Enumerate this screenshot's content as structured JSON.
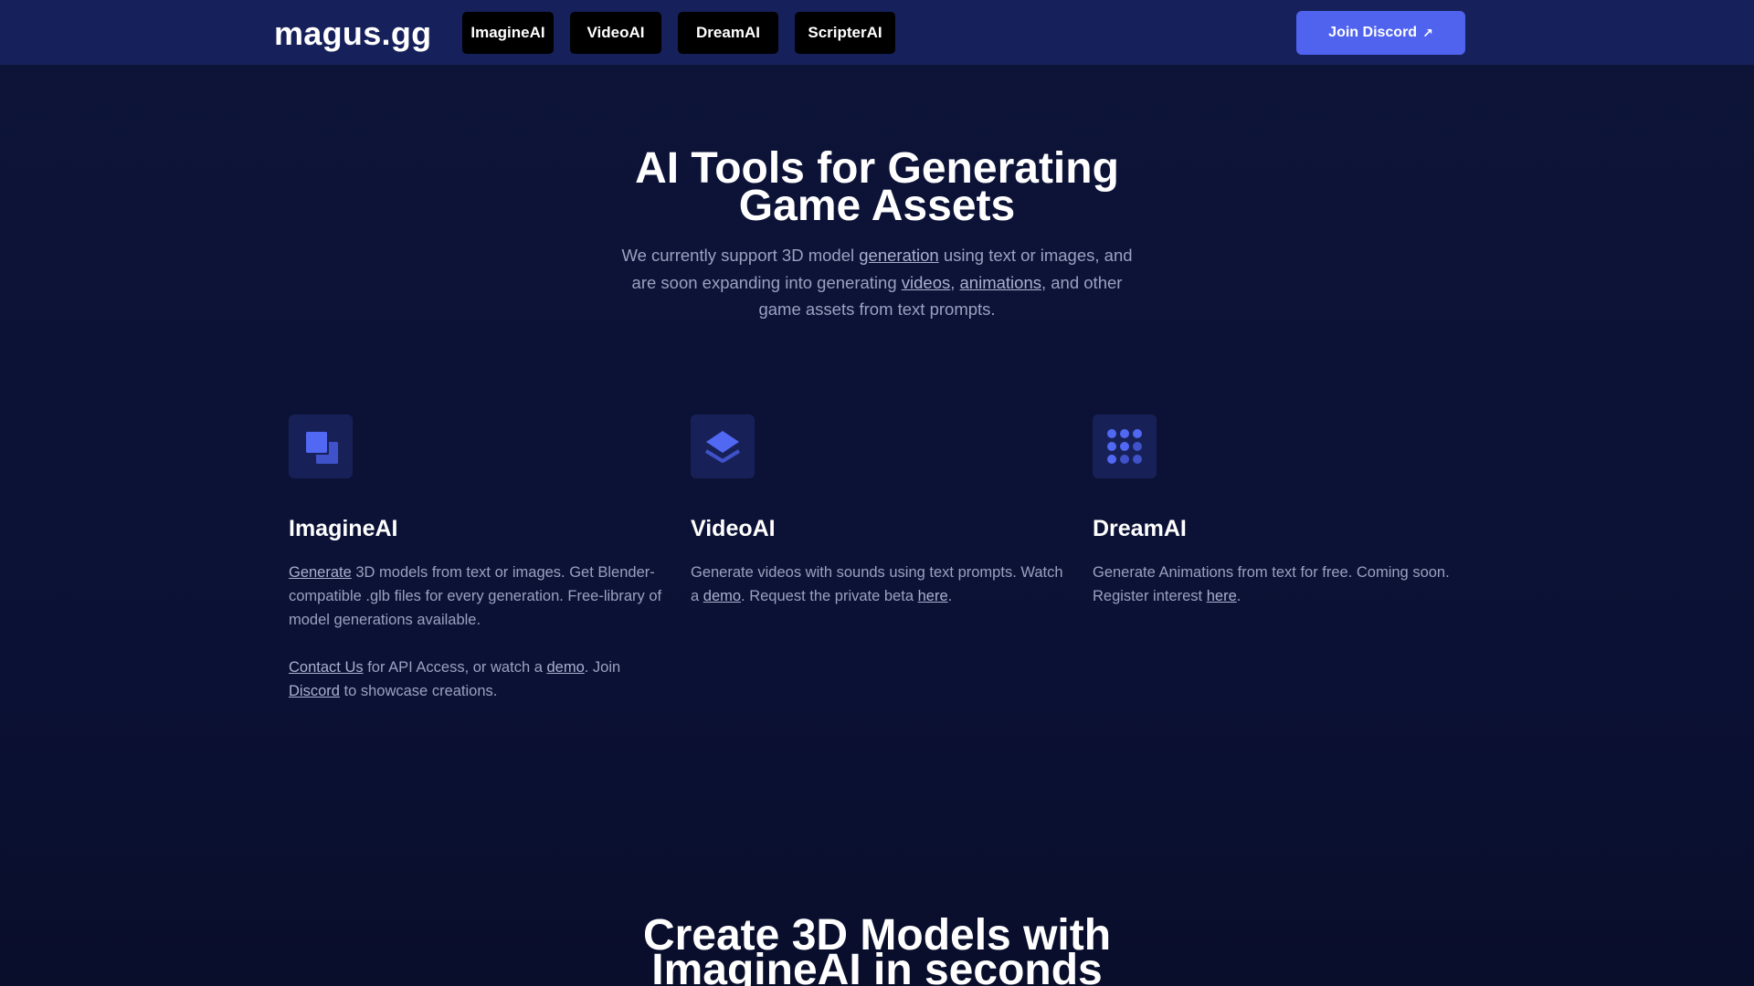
{
  "header": {
    "logo": "magus.gg",
    "nav": [
      "ImagineAI",
      "VideoAI",
      "DreamAI",
      "ScripterAI"
    ],
    "cta_label": "Join Discord",
    "cta_arrow": "↗"
  },
  "hero": {
    "title_line1": "AI Tools for Generating",
    "title_line2": "Game Assets",
    "sub_1": "We currently support 3D model ",
    "sub_link_generation": "generation",
    "sub_2": " using text or images, and are soon expanding into generating ",
    "sub_link_videos": "videos",
    "sub_3": ", ",
    "sub_link_animations": "animations",
    "sub_4": ", and other game assets from text prompts."
  },
  "features": {
    "imagine": {
      "icon": "copy-squares-icon",
      "title": "ImagineAI",
      "p1_link": "Generate",
      "p1_text": " 3D models from text or images. Get Blender-compatible .glb files for every generation. Free-library of model generations available.",
      "p2_link_contact": "Contact Us",
      "p2_text_a": " for API Access, or watch a ",
      "p2_link_demo": "demo",
      "p2_text_b": ". Join ",
      "p2_link_discord": "Discord",
      "p2_text_c": " to showcase creations."
    },
    "video": {
      "icon": "layers-icon",
      "title": "VideoAI",
      "text_a": "Generate videos with sounds using text prompts. Watch a ",
      "link_demo": "demo",
      "text_b": ". Request the private beta ",
      "link_here": "here",
      "text_c": "."
    },
    "dream": {
      "icon": "dots-grid-icon",
      "title": "DreamAI",
      "text_a": "Generate Animations from text for free. Coming soon. Register interest ",
      "link_here": "here",
      "text_b": "."
    }
  },
  "section": {
    "title_line1": "Create 3D Models with",
    "title_line2": "ImagineAI in seconds"
  },
  "colors": {
    "background": "#0c1236",
    "header": "#16205a",
    "accent": "#4f63ef",
    "icon_box": "#172158",
    "muted_text": "#9aa1c0"
  }
}
